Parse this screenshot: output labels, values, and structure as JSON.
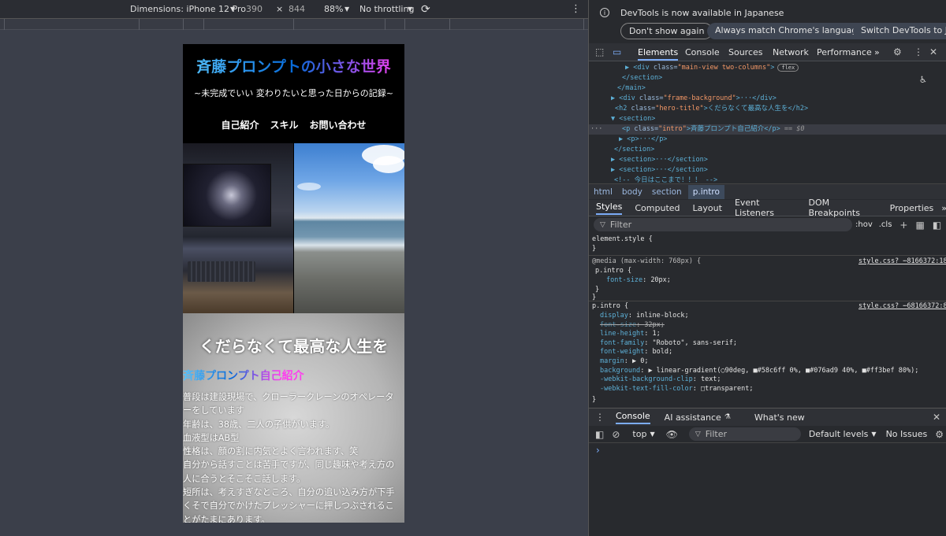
{
  "device_toolbar": {
    "dimensions": "Dimensions: iPhone 12 Pro",
    "width": "390",
    "x": "×",
    "height": "844",
    "zoom": "88%",
    "throttling": "No throttling"
  },
  "site": {
    "title": "斉藤プロンプトの小さな世界",
    "subtitle": "~未完成でいい 変わりたいと思った日からの記録~",
    "nav": [
      "自己紹介",
      "スキル",
      "お問い合わせ"
    ],
    "hero_title": "くだらなくて最高な人生を",
    "intro": "斉藤プロンプト自己紹介",
    "bio_lines": [
      "普段は建設現場で、クローラークレーンのオペレータ",
      "ーをしています",
      "年齢は、38歳、二人の子供がいます。",
      "血液型はAB型",
      "性格は、顔の割に内気とよく言われます、笑",
      "自分から話すことは苦手ですが、同じ趣味や考え方の",
      "人に合うとそこそこ話します。",
      "短所は、考えすぎなところ、自分の追い込み方が下手",
      "くそで自分でかけたプレッシャーに押しつぶされるこ",
      "とがたまにあります。"
    ]
  },
  "devtools": {
    "info_text": "DevTools is now available in Japanese",
    "buttons": [
      "Don't show again",
      "Always match Chrome's language",
      "Switch DevTools to Jap"
    ],
    "tabs": [
      "Elements",
      "Console",
      "Sources",
      "Network",
      "Performance"
    ],
    "more": "»",
    "dom": [
      {
        "pre": "▶ <",
        "tag": "div",
        "a": " class=",
        "v": "\"main-view two-columns\"",
        "post": ">",
        "badge": "flex",
        "indent": 46
      },
      {
        "pre": "</",
        "tag": "section",
        "post": ">",
        "indent": 42
      },
      {
        "pre": "</",
        "tag": "main",
        "post": ">",
        "indent": 36
      },
      {
        "pre": "▶ <",
        "tag": "div",
        "a": " class=",
        "v": "\"frame-background\"",
        "post": ">···</div>",
        "indent": 28
      },
      {
        "pre": "<",
        "tag": "h2",
        "a": " class=",
        "v": "\"hero-title\"",
        "post": ">くだらなくて最高な人生を</h2>",
        "indent": 33
      },
      {
        "pre": "▼ <",
        "tag": "section",
        "post": ">",
        "indent": 28
      },
      {
        "pre": "<",
        "tag": "p",
        "a": " class=",
        "v": "\"intro\"",
        "post": ">斉藤プロンプト自己紹介</p>",
        "eq": " == $0",
        "indent": 42,
        "selected": true
      },
      {
        "pre": "▶ <",
        "tag": "p",
        "post": ">···</p>",
        "indent": 38
      },
      {
        "pre": "</",
        "tag": "section",
        "post": ">",
        "indent": 32
      },
      {
        "pre": "▶ <",
        "tag": "section",
        "post": ">···</section>",
        "indent": 28
      },
      {
        "pre": "▶ <",
        "tag": "section",
        "post": ">···</section>",
        "indent": 28
      },
      {
        "pre": "<!-- ",
        "tag": "",
        "post": "今日はここまで！！！ -->",
        "indent": 32
      }
    ],
    "breadcrumbs": [
      "html",
      "body",
      "section",
      "p.intro"
    ],
    "style_tabs": [
      "Styles",
      "Computed",
      "Layout",
      "Event Listeners",
      "DOM Breakpoints",
      "Properties"
    ],
    "filter_placeholder": "Filter",
    "hov": ":hov",
    "cls": ".cls",
    "element_style": "element.style {",
    "media_line": "@media (max-width: 768px) {",
    "media_src": "style.css?_⋯8166372:186",
    "media_rule": "p.intro {",
    "media_prop": "font-size",
    "media_val": "20px;",
    "rule2": "p.intro {",
    "rule2_src": "style.css?_⋯68166372:80",
    "props": [
      {
        "n": "display",
        "v": "inline-block;"
      },
      {
        "n": "font-size",
        "v": "32px;",
        "struck": true
      },
      {
        "n": "line-height",
        "v": "1;"
      },
      {
        "n": "font-family",
        "v": "\"Roboto\", sans-serif;"
      },
      {
        "n": "font-weight",
        "v": "bold;"
      },
      {
        "n": "margin",
        "v": "▶ 0;"
      },
      {
        "n": "background",
        "v": "▶ linear-gradient(◯90deg, ■#58c6ff 0%, ■#076ad9 40%, ■#ff3bef 80%);"
      },
      {
        "n": "-webkit-background-clip",
        "v": "text;"
      },
      {
        "n": "-webkit-text-fill-color",
        "v": "□transparent;"
      }
    ],
    "colors": {
      "c1": "#58c6ff",
      "c2": "#076ad9",
      "c3": "#ff3bef",
      "accent": "#7cacf8"
    },
    "drawer_tabs": [
      "Console",
      "AI assistance",
      "What's new"
    ],
    "console": {
      "context": "top",
      "filter": "Filter",
      "levels": "Default levels",
      "issues": "No Issues",
      "prompt": "›"
    }
  }
}
